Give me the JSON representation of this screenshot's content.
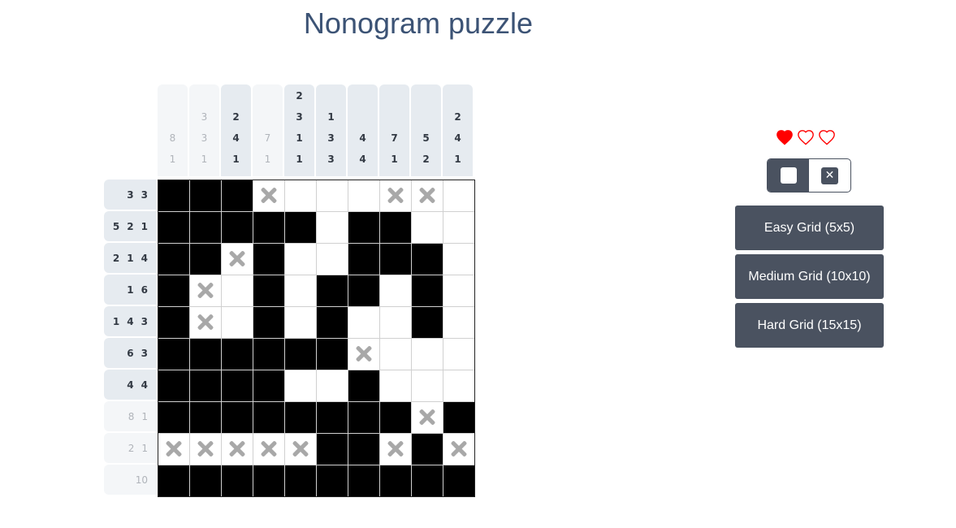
{
  "title": "Nonogram puzzle",
  "column_clues": [
    {
      "numbers": [
        "8",
        "1"
      ],
      "done": true
    },
    {
      "numbers": [
        "3",
        "3",
        "1"
      ],
      "done": true
    },
    {
      "numbers": [
        "2",
        "4",
        "1"
      ],
      "done": false
    },
    {
      "numbers": [
        "7",
        "1"
      ],
      "done": true
    },
    {
      "numbers": [
        "2",
        "3",
        "1",
        "1"
      ],
      "done": false
    },
    {
      "numbers": [
        "1",
        "3",
        "3"
      ],
      "done": false
    },
    {
      "numbers": [
        "4",
        "4"
      ],
      "done": false
    },
    {
      "numbers": [
        "7",
        "1"
      ],
      "done": false
    },
    {
      "numbers": [
        "5",
        "2"
      ],
      "done": false
    },
    {
      "numbers": [
        "2",
        "4",
        "1"
      ],
      "done": false
    }
  ],
  "row_clues": [
    {
      "numbers": [
        "3",
        "3"
      ],
      "done": false
    },
    {
      "numbers": [
        "5",
        "2",
        "1"
      ],
      "done": false
    },
    {
      "numbers": [
        "2",
        "1",
        "4"
      ],
      "done": false
    },
    {
      "numbers": [
        "1",
        "6"
      ],
      "done": false
    },
    {
      "numbers": [
        "1",
        "4",
        "3"
      ],
      "done": false
    },
    {
      "numbers": [
        "6",
        "3"
      ],
      "done": false
    },
    {
      "numbers": [
        "4",
        "4"
      ],
      "done": false
    },
    {
      "numbers": [
        "8",
        "1"
      ],
      "done": true
    },
    {
      "numbers": [
        "2",
        "1"
      ],
      "done": true
    },
    {
      "numbers": [
        "10"
      ],
      "done": true
    }
  ],
  "grid": [
    "FFFX...XX.",
    "FFFFF.FF..",
    "FFXF..FFF.",
    "FX.F.FF.F.",
    "FX.F.F..F.",
    "FFFFFFX...",
    "FFFF..F...",
    "FFFFFFFFXF",
    "XXXXXFFXFX",
    "FFFFFFFFFF"
  ],
  "lives": {
    "total": 3,
    "remaining": 1,
    "color": "#ff0000"
  },
  "mode": {
    "selected": "fill",
    "fill_icon": "fill-square-icon",
    "cross_icon": "cross-icon",
    "cross_glyph": "✕"
  },
  "buttons": {
    "easy": "Easy Grid (5x5)",
    "medium": "Medium Grid (10x10)",
    "hard": "Hard Grid (15x15)"
  }
}
